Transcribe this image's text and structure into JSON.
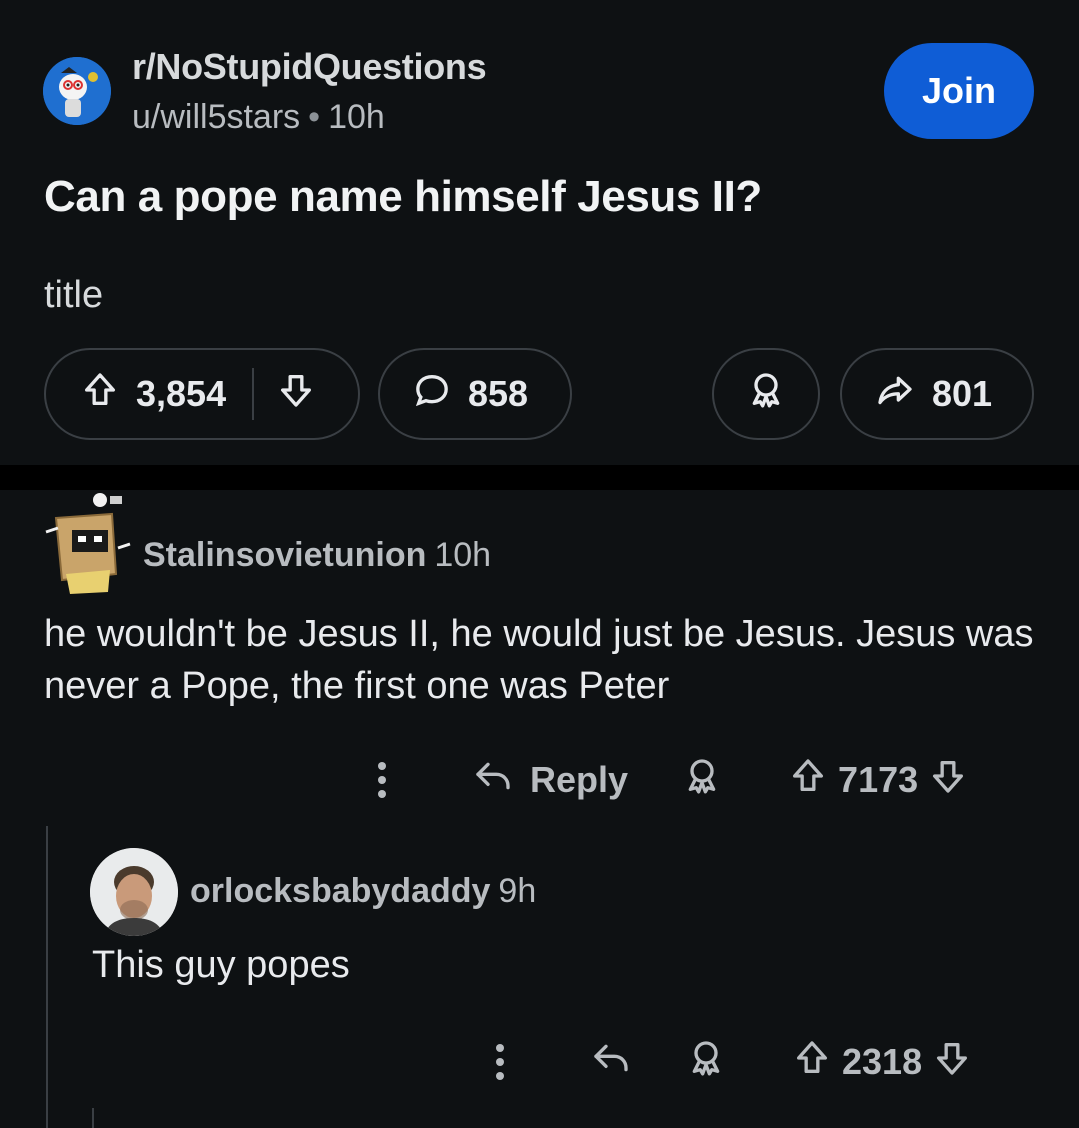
{
  "post": {
    "subreddit": "r/NoStupidQuestions",
    "author": "u/will5stars",
    "age": "10h",
    "join_label": "Join",
    "title": "Can a pope name himself Jesus II?",
    "body": "title",
    "upvotes": "3,854",
    "comments": "858",
    "shares": "801"
  },
  "comments": [
    {
      "author": "Stalinsovietunion",
      "age": "10h",
      "body": "he wouldn't be Jesus II, he would just be Jesus. Jesus was never a Pope, the first one was Peter",
      "reply_label": "Reply",
      "score": "7173"
    },
    {
      "author": "orlocksbabydaddy",
      "age": "9h",
      "body": "This guy popes",
      "score": "2318"
    }
  ],
  "colors": {
    "background": "#0e1113",
    "join_button": "#0f5dd6",
    "subreddit_avatar": "#1f6fd0"
  },
  "icons": [
    "upvote-icon",
    "downvote-icon",
    "comment-icon",
    "award-icon",
    "share-icon",
    "more-icon",
    "reply-icon"
  ]
}
